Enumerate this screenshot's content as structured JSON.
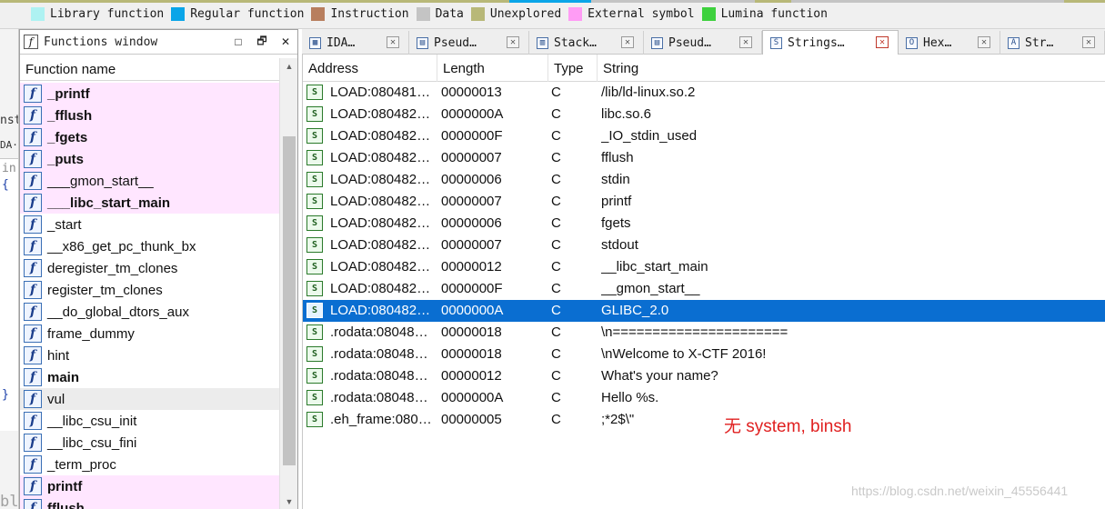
{
  "legend": {
    "items": [
      {
        "label": "Library function",
        "color": "#aef2f2"
      },
      {
        "label": "Regular function",
        "color": "#0aa5e8"
      },
      {
        "label": "Instruction",
        "color": "#b87e5e"
      },
      {
        "label": "Data",
        "color": "#c4c4c4"
      },
      {
        "label": "Unexplored",
        "color": "#b8b878"
      },
      {
        "label": "External symbol",
        "color": "#ff9cf5"
      },
      {
        "label": "Lumina function",
        "color": "#3ed13e"
      }
    ]
  },
  "gutter": {
    "frag1": "nst",
    "frag2": "DA·",
    "frag3": "in",
    "frag4": "{",
    "frag5": "}",
    "frag6": "blo"
  },
  "functions_window": {
    "title": "Functions window",
    "title_icon": "f",
    "column_header": "Function name",
    "btn_min": "□",
    "btn_float": "🗗",
    "btn_close": "✕",
    "items": [
      {
        "name": "_printf",
        "lib": true,
        "bold": true
      },
      {
        "name": "_fflush",
        "lib": true,
        "bold": true
      },
      {
        "name": "_fgets",
        "lib": true,
        "bold": true
      },
      {
        "name": "_puts",
        "lib": true,
        "bold": true
      },
      {
        "name": "___gmon_start__",
        "lib": true,
        "bold": false
      },
      {
        "name": "___libc_start_main",
        "lib": true,
        "bold": true
      },
      {
        "name": "_start",
        "lib": false,
        "bold": false
      },
      {
        "name": "__x86_get_pc_thunk_bx",
        "lib": false,
        "bold": false
      },
      {
        "name": "deregister_tm_clones",
        "lib": false,
        "bold": false
      },
      {
        "name": "register_tm_clones",
        "lib": false,
        "bold": false
      },
      {
        "name": "__do_global_dtors_aux",
        "lib": false,
        "bold": false
      },
      {
        "name": "frame_dummy",
        "lib": false,
        "bold": false
      },
      {
        "name": "hint",
        "lib": false,
        "bold": false
      },
      {
        "name": "main",
        "lib": false,
        "bold": true
      },
      {
        "name": "vul",
        "lib": false,
        "bold": false,
        "selected": true
      },
      {
        "name": "__libc_csu_init",
        "lib": false,
        "bold": false
      },
      {
        "name": "__libc_csu_fini",
        "lib": false,
        "bold": false
      },
      {
        "name": "_term_proc",
        "lib": false,
        "bold": false
      },
      {
        "name": "printf",
        "lib": true,
        "bold": true
      },
      {
        "name": "fflush",
        "lib": true,
        "bold": true
      }
    ]
  },
  "tabs": [
    {
      "label": "IDA…",
      "icon": "▦",
      "active": false
    },
    {
      "label": "Pseud…",
      "icon": "▤",
      "active": false
    },
    {
      "label": "Stack…",
      "icon": "▥",
      "active": false
    },
    {
      "label": "Pseud…",
      "icon": "▤",
      "active": false
    },
    {
      "label": "Strings…",
      "icon": "S",
      "active": true
    },
    {
      "label": "Hex…",
      "icon": "O",
      "active": false
    },
    {
      "label": "Str…",
      "icon": "A",
      "active": false
    }
  ],
  "strings": {
    "headers": {
      "address": "Address",
      "length": "Length",
      "type": "Type",
      "string": "String"
    },
    "row_icon": "S",
    "rows": [
      {
        "address": "LOAD:080481…",
        "length": "00000013",
        "type": "C",
        "string": "/lib/ld-linux.so.2"
      },
      {
        "address": "LOAD:080482…",
        "length": "0000000A",
        "type": "C",
        "string": "libc.so.6"
      },
      {
        "address": "LOAD:080482…",
        "length": "0000000F",
        "type": "C",
        "string": "_IO_stdin_used"
      },
      {
        "address": "LOAD:080482…",
        "length": "00000007",
        "type": "C",
        "string": "fflush"
      },
      {
        "address": "LOAD:080482…",
        "length": "00000006",
        "type": "C",
        "string": "stdin"
      },
      {
        "address": "LOAD:080482…",
        "length": "00000007",
        "type": "C",
        "string": "printf"
      },
      {
        "address": "LOAD:080482…",
        "length": "00000006",
        "type": "C",
        "string": "fgets"
      },
      {
        "address": "LOAD:080482…",
        "length": "00000007",
        "type": "C",
        "string": "stdout"
      },
      {
        "address": "LOAD:080482…",
        "length": "00000012",
        "type": "C",
        "string": "__libc_start_main"
      },
      {
        "address": "LOAD:080482…",
        "length": "0000000F",
        "type": "C",
        "string": "__gmon_start__"
      },
      {
        "address": "LOAD:080482…",
        "length": "0000000A",
        "type": "C",
        "string": "GLIBC_2.0",
        "selected": true
      },
      {
        "address": ".rodata:08048…",
        "length": "00000018",
        "type": "C",
        "string": "\\n======================"
      },
      {
        "address": ".rodata:08048…",
        "length": "00000018",
        "type": "C",
        "string": "\\nWelcome to X-CTF 2016!"
      },
      {
        "address": ".rodata:08048…",
        "length": "00000012",
        "type": "C",
        "string": "What's your name?"
      },
      {
        "address": ".rodata:08048…",
        "length": "0000000A",
        "type": "C",
        "string": "Hello %s."
      },
      {
        "address": ".eh_frame:080…",
        "length": "00000005",
        "type": "C",
        "string": ";*2$\\\""
      }
    ]
  },
  "annotation": "无  system, binsh",
  "watermark": "https://blog.csdn.net/weixin_45556441"
}
